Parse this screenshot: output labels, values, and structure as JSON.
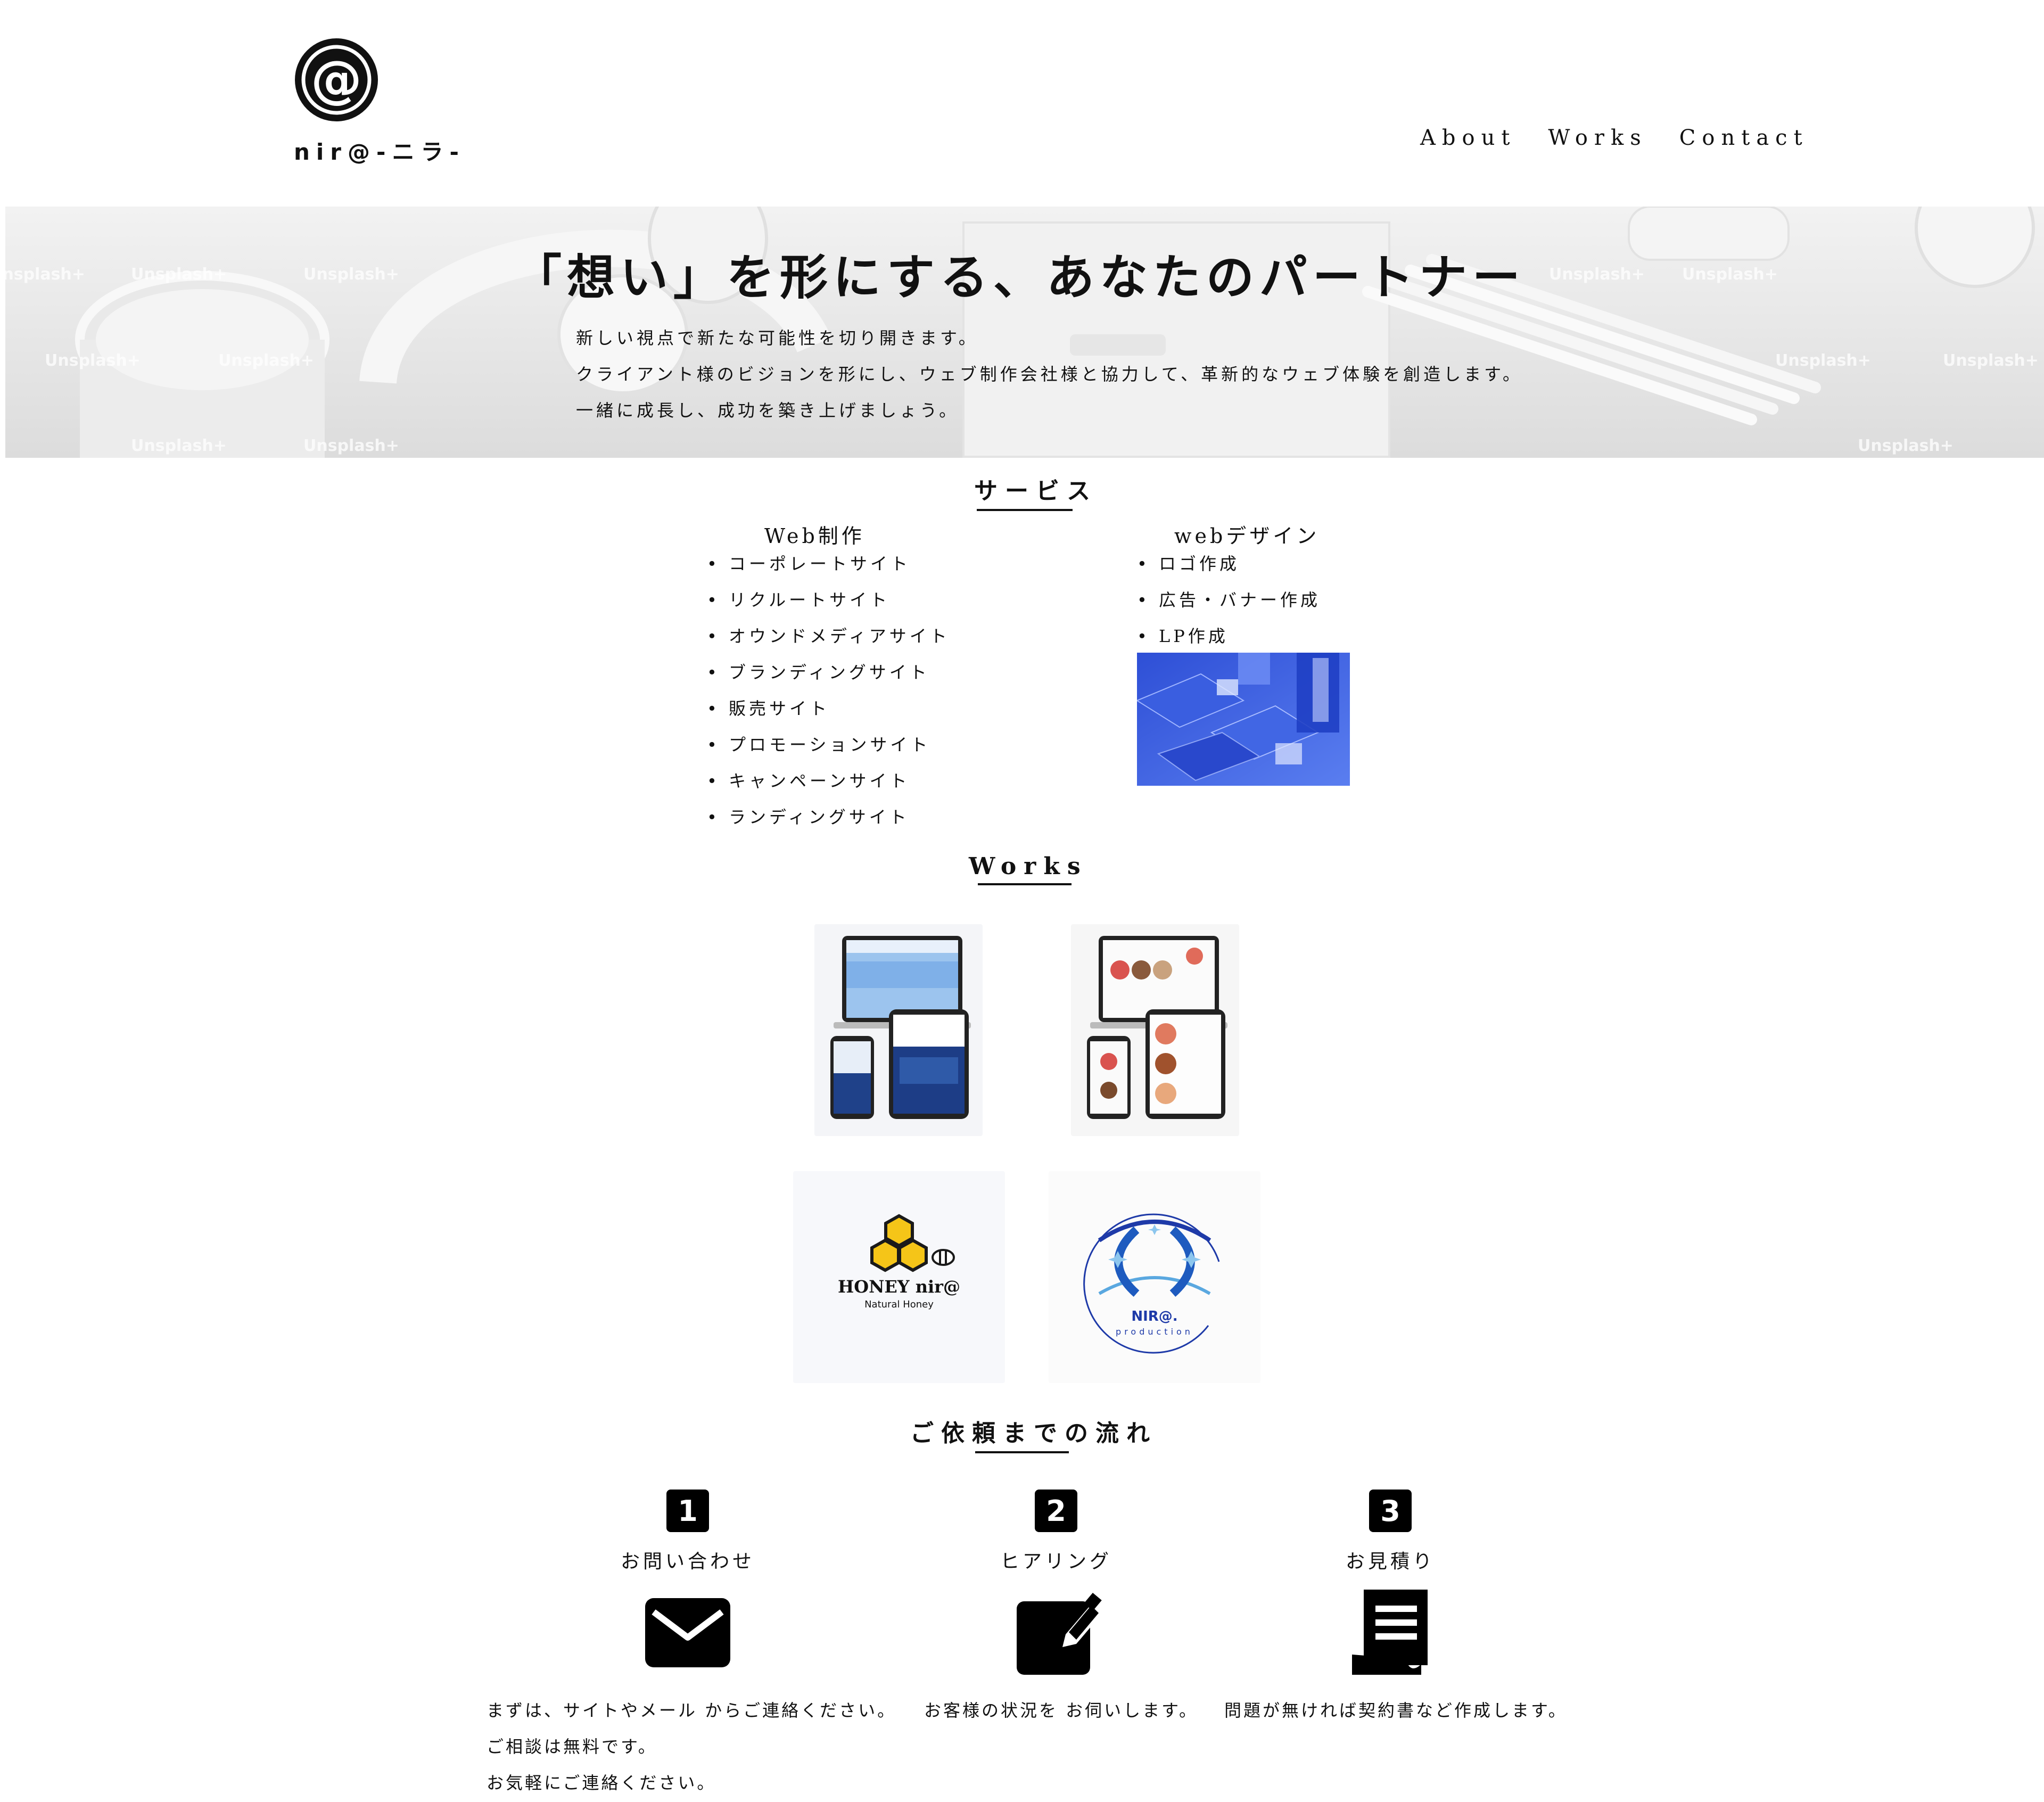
{
  "header": {
    "brand": "nir@-ニラ-",
    "nav": [
      {
        "label": "About"
      },
      {
        "label": "Works"
      },
      {
        "label": "Contact"
      }
    ]
  },
  "hero": {
    "title": "「想い」を形にする、あなたのパートナー",
    "lines": [
      "新しい視点で新たな可能性を切り開きます。",
      "クライアント様のビジョンを形にし、ウェブ制作会社様と協力して、革新的なウェブ体験を創造します。",
      "一緒に成長し、成功を築き上げましょう。"
    ],
    "watermark": "Unsplash+"
  },
  "services": {
    "heading": "サービス",
    "columns": [
      {
        "title": "Web制作",
        "items": [
          "コーポレートサイト",
          "リクルートサイト",
          "オウンドメディアサイト",
          "ブランディングサイト",
          "販売サイト",
          "プロモーションサイト",
          "キャンペーンサイト",
          "ランディングサイト"
        ]
      },
      {
        "title": "webデザイン",
        "items": [
          "ロゴ作成",
          "広告・バナー作成",
          "LP作成"
        ]
      }
    ]
  },
  "works": {
    "heading": "Works",
    "honey_logo": {
      "title": "HONEY nir@",
      "subtitle": "Natural Honey"
    },
    "nira_logo": {
      "title": "NIR@.",
      "subtitle": "production"
    }
  },
  "flow": {
    "heading": "ご依頼までの流れ",
    "steps": [
      {
        "num": "1",
        "title": "お問い合わせ",
        "icon": "mail-icon",
        "desc": [
          "まずは、サイトやメール からご連絡ください。",
          "ご相談は無料です。",
          "お気軽にご連絡ください。"
        ]
      },
      {
        "num": "2",
        "title": "ヒアリング",
        "icon": "edit-icon",
        "desc": [
          "お客様の状況を お伺いします。"
        ]
      },
      {
        "num": "3",
        "title": "お見積り",
        "icon": "document-icon",
        "desc": [
          "問題が無ければ契約書など作成します。"
        ]
      }
    ]
  },
  "colors": {
    "text": "#111111",
    "background": "#ffffff",
    "accent_blue": "#1f4fd0"
  }
}
